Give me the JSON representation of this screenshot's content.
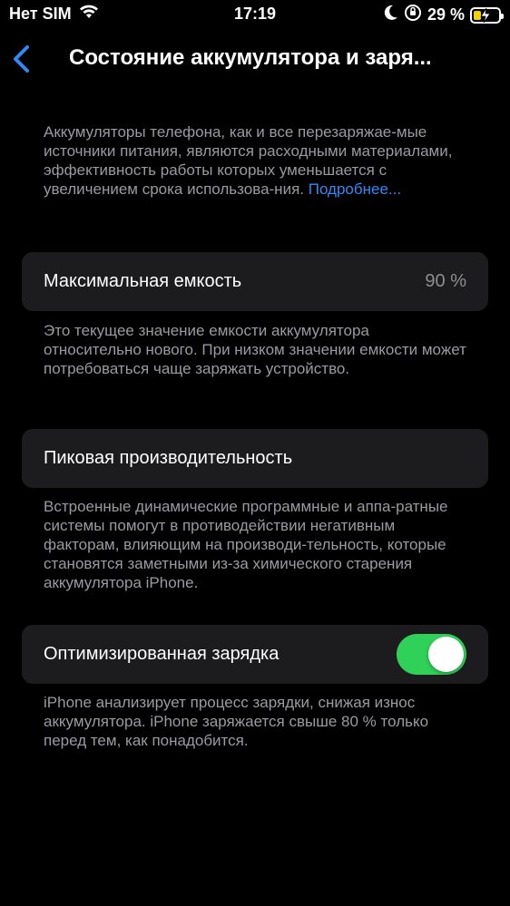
{
  "status_bar": {
    "carrier": "Нет SIM",
    "time": "17:19",
    "battery_percent": "29 %",
    "battery_level": 0.29,
    "icons": [
      "wifi-icon",
      "moon-icon",
      "orientation-lock-icon",
      "battery-charging-icon"
    ]
  },
  "nav": {
    "title": "Состояние аккумулятора и заря..."
  },
  "intro": {
    "text": "Аккумуляторы телефона, как и все перезаряжае-мые источники питания, являются расходными материалами, эффективность работы которых уменьшается с увеличением срока использова-ния.",
    "link": "Подробнее..."
  },
  "max_capacity": {
    "label": "Максимальная емкость",
    "value": "90 %",
    "description": "Это текущее значение емкости аккумулятора относительно нового. При низком значении емкости может потребоваться чаще заряжать устройство."
  },
  "peak_performance": {
    "label": "Пиковая производительность",
    "description": "Встроенные динамические программные и аппа-ратные системы помогут в противодействии негативным факторам, влияющим на производи-тельность, которые становятся заметными из-за химического старения аккумулятора iPhone."
  },
  "optimized_charging": {
    "label": "Оптимизированная зарядка",
    "enabled": true,
    "description": "iPhone анализирует процесс зарядки, снижая износ аккумулятора. iPhone заряжается свыше 80 % только перед тем, как понадобится."
  },
  "colors": {
    "background": "#000000",
    "card": "#1c1c1e",
    "accent": "#2f8af5",
    "toggle_on": "#30d158",
    "battery_fill": "#f5d000"
  }
}
